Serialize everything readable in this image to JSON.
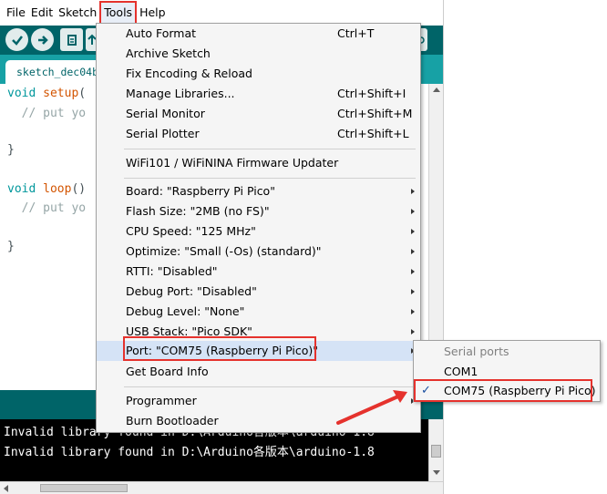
{
  "menubar": {
    "items": [
      "File",
      "Edit",
      "Sketch",
      "Tools",
      "Help"
    ],
    "active": "Tools"
  },
  "toolbar": {
    "buttons": [
      "verify-icon",
      "upload-icon",
      "new-icon",
      "open-icon",
      "serial-monitor-icon"
    ]
  },
  "tabs": {
    "active_label": "sketch_dec04b"
  },
  "editor": {
    "lines": [
      {
        "type": "void",
        "fn": "setup",
        "rest": "("
      },
      {
        "comment": "// put yo"
      },
      {
        "plain": "}"
      },
      {
        "type": "void",
        "fn": "loop",
        "rest": "()"
      },
      {
        "comment": "// put yo"
      },
      {
        "plain": "}"
      }
    ]
  },
  "console": {
    "lines": [
      "Invalid library found in D:\\Arduino各版本\\arduino-1.8",
      "Invalid library found in D:\\Arduino各版本\\arduino-1.8"
    ]
  },
  "tools_menu": {
    "items": [
      {
        "label": "Auto Format",
        "shortcut": "Ctrl+T"
      },
      {
        "label": "Archive Sketch",
        "shortcut": ""
      },
      {
        "label": "Fix Encoding & Reload",
        "shortcut": ""
      },
      {
        "label": "Manage Libraries...",
        "shortcut": "Ctrl+Shift+I"
      },
      {
        "label": "Serial Monitor",
        "shortcut": "Ctrl+Shift+M"
      },
      {
        "label": "Serial Plotter",
        "shortcut": "Ctrl+Shift+L"
      },
      {
        "label": "WiFi101 / WiFiNINA Firmware Updater",
        "shortcut": ""
      },
      {
        "label": "Board: \"Raspberry Pi Pico\"",
        "submenu": true
      },
      {
        "label": "Flash Size: \"2MB (no FS)\"",
        "submenu": true
      },
      {
        "label": "CPU Speed: \"125 MHz\"",
        "submenu": true
      },
      {
        "label": "Optimize: \"Small (-Os) (standard)\"",
        "submenu": true
      },
      {
        "label": "RTTI: \"Disabled\"",
        "submenu": true
      },
      {
        "label": "Debug Port: \"Disabled\"",
        "submenu": true
      },
      {
        "label": "Debug Level: \"None\"",
        "submenu": true
      },
      {
        "label": "USB Stack: \"Pico SDK\"",
        "submenu": true
      },
      {
        "label": "Port: \"COM75 (Raspberry Pi Pico)\"",
        "submenu": true,
        "highlighted": true
      },
      {
        "label": "Get Board Info",
        "shortcut": ""
      },
      {
        "label": "Programmer",
        "submenu": true
      },
      {
        "label": "Burn Bootloader",
        "shortcut": ""
      }
    ]
  },
  "port_submenu": {
    "header": "Serial ports",
    "items": [
      {
        "label": "COM1",
        "checked": false
      },
      {
        "label": "COM75 (Raspberry Pi Pico)",
        "checked": true
      }
    ],
    "check_glyph": "✓"
  },
  "colors": {
    "toolbar": "#006468",
    "tabstrip": "#17a1a5",
    "annotation": "#e5322d",
    "highlight": "#d5e3f6"
  }
}
